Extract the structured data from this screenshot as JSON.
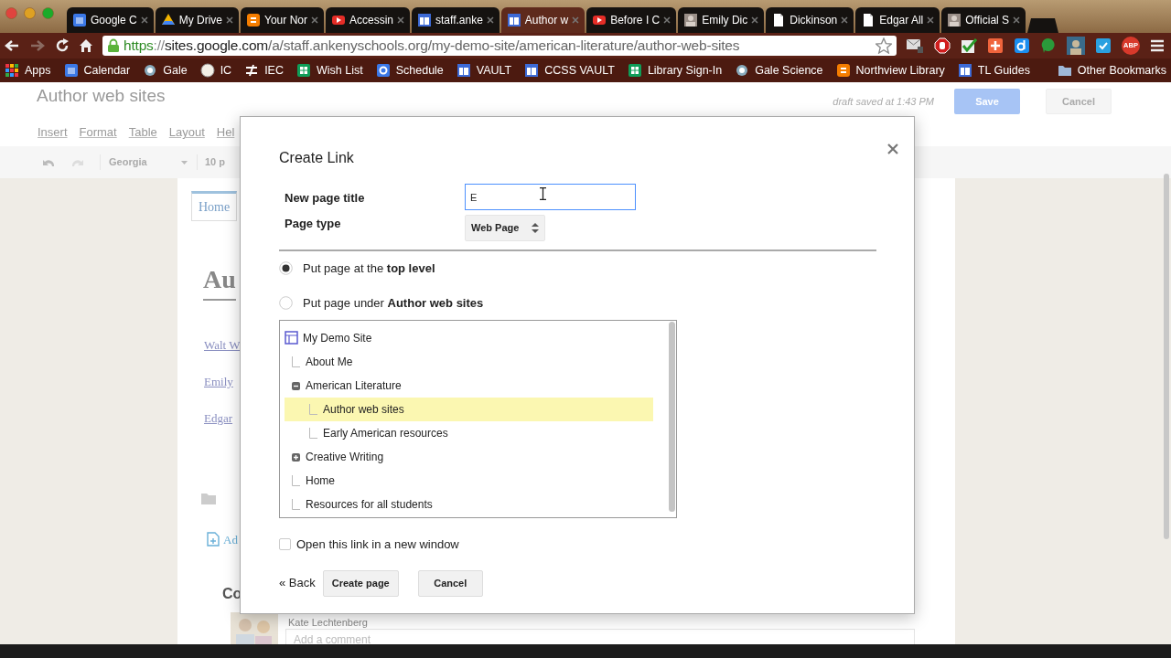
{
  "browser": {
    "tabs": [
      {
        "title": "Google C",
        "kind": "calendar",
        "selected": false
      },
      {
        "title": "My Drive",
        "kind": "drive",
        "selected": false
      },
      {
        "title": "Your Nor",
        "kind": "blogger",
        "selected": false
      },
      {
        "title": "Accessin",
        "kind": "youtube",
        "selected": false
      },
      {
        "title": "staff.anke",
        "kind": "sites",
        "selected": false
      },
      {
        "title": "Author w",
        "kind": "sites",
        "selected": true
      },
      {
        "title": "Before I C",
        "kind": "youtube",
        "selected": false
      },
      {
        "title": "Emily Dic",
        "selected": false
      },
      {
        "title": "Dickinson",
        "kind": "doc",
        "selected": false
      },
      {
        "title": "Edgar All",
        "kind": "doc",
        "selected": false
      },
      {
        "title": "Official S",
        "selected": false
      }
    ],
    "url": {
      "scheme": "https",
      "separator": "://",
      "host": "sites.google.com",
      "path": "/a/staff.ankenyschools.org/my-demo-site/american-literature/author-web-sites"
    },
    "extension_badge": "ABP",
    "bookmarks": [
      {
        "label": "Apps",
        "kind": "apps"
      },
      {
        "label": "Calendar",
        "kind": "calendar"
      },
      {
        "label": "Gale",
        "kind": "gale"
      },
      {
        "label": "IC",
        "kind": "circle"
      },
      {
        "label": "IEC",
        "kind": "iec"
      },
      {
        "label": "Wish List",
        "kind": "sheet"
      },
      {
        "label": "Schedule",
        "kind": "google"
      },
      {
        "label": "VAULT",
        "kind": "sites"
      },
      {
        "label": "CCSS VAULT",
        "kind": "sites"
      },
      {
        "label": "Library Sign-In",
        "kind": "sheet"
      },
      {
        "label": "Gale Science",
        "kind": "gale"
      },
      {
        "label": "Northview Library",
        "kind": "blogger"
      },
      {
        "label": "TL Guides",
        "kind": "sites"
      },
      {
        "label": "Other Bookmarks",
        "kind": "folder"
      }
    ]
  },
  "editor": {
    "page_title": "Author web sites",
    "draft_status": "draft saved at 1:43 PM",
    "save": "Save",
    "cancel": "Cancel",
    "menus": [
      "Insert",
      "Format",
      "Table",
      "Layout",
      "Hel"
    ],
    "font": "Georgia",
    "font_size": "10 p",
    "nav_tab": "Home",
    "heading": "Au",
    "links": [
      "Walt W",
      "Emily",
      "Edgar"
    ],
    "add_link": "Ad",
    "comments_heading": "Co",
    "commenter": "Kate Lechtenberg",
    "comment_placeholder": "Add a comment"
  },
  "dialog": {
    "title": "Create Link",
    "title_label": "New page title",
    "title_value": "E",
    "type_label": "Page type",
    "type_value": "Web Page",
    "placements": [
      {
        "text": "Put page at the **top level**",
        "selected": true
      },
      {
        "text": "Put page under **Author web sites**",
        "selected": false
      }
    ],
    "tree": {
      "label": "My Demo Site",
      "children": [
        {
          "label": "About Me",
          "selected": false
        },
        {
          "label": "American Literature",
          "selected": false,
          "expanded": true,
          "children": [
            {
              "label": "Author web sites",
              "selected": true
            },
            {
              "label": "Early American resources",
              "selected": false
            }
          ]
        },
        {
          "label": "Creative Writing",
          "selected": false,
          "expanded": false
        },
        {
          "label": "Home",
          "selected": false
        },
        {
          "label": "Resources for all students",
          "selected": false
        }
      ]
    },
    "new_window": {
      "label": "Open this link in a new window",
      "checked": false
    },
    "back": "« Back",
    "create": "Create page",
    "cancel": "Cancel"
  }
}
